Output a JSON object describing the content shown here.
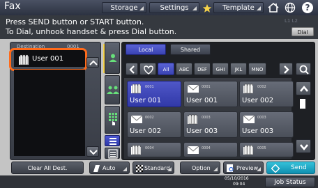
{
  "header": {
    "title": "Fax",
    "tabs": [
      "Storage",
      "Settings",
      "Template"
    ]
  },
  "message": {
    "line1": "Press SEND button or START button.",
    "line2": "To Dial, unhook handset & press Dial button.",
    "lines_indicator": "L1 L2",
    "dial_label": "Dial"
  },
  "destination": {
    "label": "Destination",
    "count": "0001",
    "selected": "User 001"
  },
  "addressbook": {
    "tabs": [
      "Local",
      "Shared"
    ],
    "index": [
      "All",
      "ABC",
      "DEF",
      "GHI",
      "JKL",
      "MNO"
    ],
    "entries": [
      {
        "num": "0001",
        "name": "User 001",
        "type": "group"
      },
      {
        "num": "0001",
        "name": "User 001",
        "type": "mail"
      },
      {
        "num": "0002",
        "name": "User 002",
        "type": "group"
      },
      {
        "num": "0002",
        "name": "User 002",
        "type": "mail"
      },
      {
        "num": "0003",
        "name": "User 003",
        "type": "group"
      },
      {
        "num": "0003",
        "name": "User 003",
        "type": "mail"
      },
      {
        "num": "0004",
        "name": "",
        "type": "group"
      },
      {
        "num": "0004",
        "name": "",
        "type": "mail"
      },
      {
        "num": "0005",
        "name": "",
        "type": "group"
      }
    ]
  },
  "bottom": {
    "clear": "Clear All Dest.",
    "auto": "Auto",
    "standard": "Standard",
    "option": "Option",
    "preview": "Preview",
    "send": "Send"
  },
  "status": {
    "date": "05/10/2016",
    "time": "09:04",
    "job": "Job Status"
  }
}
